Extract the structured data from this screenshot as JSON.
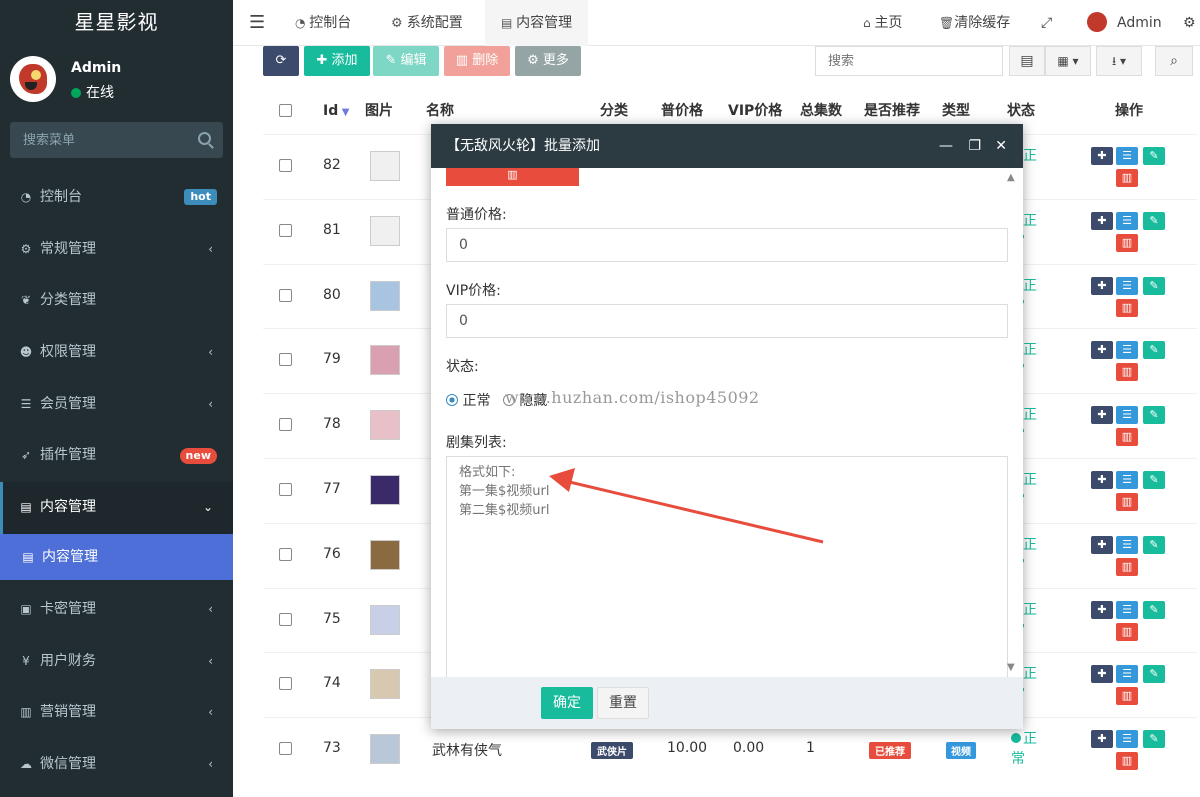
{
  "brand": "星星影视",
  "user": {
    "name": "Admin",
    "status": "在线"
  },
  "sidebar_search_placeholder": "搜索菜单",
  "menu": [
    {
      "label": "控制台",
      "icon": "dashboard-icon",
      "badge": "hot"
    },
    {
      "label": "常规管理",
      "icon": "cogs-icon",
      "arrow": "‹"
    },
    {
      "label": "分类管理",
      "icon": "leaf-icon"
    },
    {
      "label": "权限管理",
      "icon": "group-icon",
      "arrow": "‹"
    },
    {
      "label": "会员管理",
      "icon": "list-icon",
      "arrow": "‹"
    },
    {
      "label": "插件管理",
      "icon": "rocket-icon",
      "badge": "new"
    },
    {
      "label": "内容管理",
      "icon": "file-icon",
      "arrow": "⌄"
    },
    {
      "label": "内容管理",
      "icon": "file-icon",
      "sub": true
    },
    {
      "label": "卡密管理",
      "icon": "image-icon",
      "arrow": "‹"
    },
    {
      "label": "用户财务",
      "icon": "yen-icon",
      "arrow": "‹"
    },
    {
      "label": "营销管理",
      "icon": "bar-chart-icon",
      "arrow": "‹"
    },
    {
      "label": "微信管理",
      "icon": "wechat-icon",
      "arrow": "‹"
    }
  ],
  "topbar": {
    "tabs": [
      "控制台",
      "系统配置",
      "内容管理"
    ],
    "home": "主页",
    "clear_cache": "清除缓存",
    "admin": "Admin"
  },
  "toolbar": {
    "add": "添加",
    "edit": "编辑",
    "delete": "删除",
    "more": "更多",
    "search_placeholder": "搜索"
  },
  "table": {
    "headers": [
      "Id",
      "图片",
      "名称",
      "分类",
      "普价格",
      "VIP价格",
      "总集数",
      "是否推荐",
      "类型",
      "状态",
      "操作"
    ],
    "rows": [
      {
        "id": "82",
        "status1": "正",
        "status2": ""
      },
      {
        "id": "81",
        "status1": "正",
        "status2": "常"
      },
      {
        "id": "80",
        "status1": "正",
        "status2": "常"
      },
      {
        "id": "79",
        "status1": "正",
        "status2": "常"
      },
      {
        "id": "78",
        "status1": "正",
        "status2": "常"
      },
      {
        "id": "77",
        "status1": "正",
        "status2": "常"
      },
      {
        "id": "76",
        "status1": "正",
        "status2": "常"
      },
      {
        "id": "75",
        "status1": "正",
        "status2": "常"
      },
      {
        "id": "74",
        "status1": "正",
        "status2": "常"
      },
      {
        "id": "73",
        "name": "武林有侠气",
        "category": "武侠片",
        "price": "10.00",
        "vip": "0.00",
        "episodes": "1",
        "recommend": "已推荐",
        "type": "视频",
        "status1": "正",
        "status2": "常"
      }
    ]
  },
  "modal": {
    "title": "【无敌风火轮】批量添加",
    "price_label": "普通价格:",
    "price_value": "0",
    "vip_label": "VIP价格:",
    "vip_value": "0",
    "status_label": "状态:",
    "status_normal": "正常",
    "status_hidden": "隐藏",
    "episodes_label": "剧集列表:",
    "episodes_placeholder": "格式如下:\n第一集$视频url\n第二集$视频url",
    "confirm": "确定",
    "reset": "重置"
  },
  "watermark": "www.huzhan.com/ishop45092",
  "colors": {
    "primary": "#3c4a6b",
    "success": "#18bc9c",
    "danger": "#e74c3c",
    "info": "#3498db",
    "sidebar": "#222d32",
    "modal_header": "#2c3b41"
  }
}
